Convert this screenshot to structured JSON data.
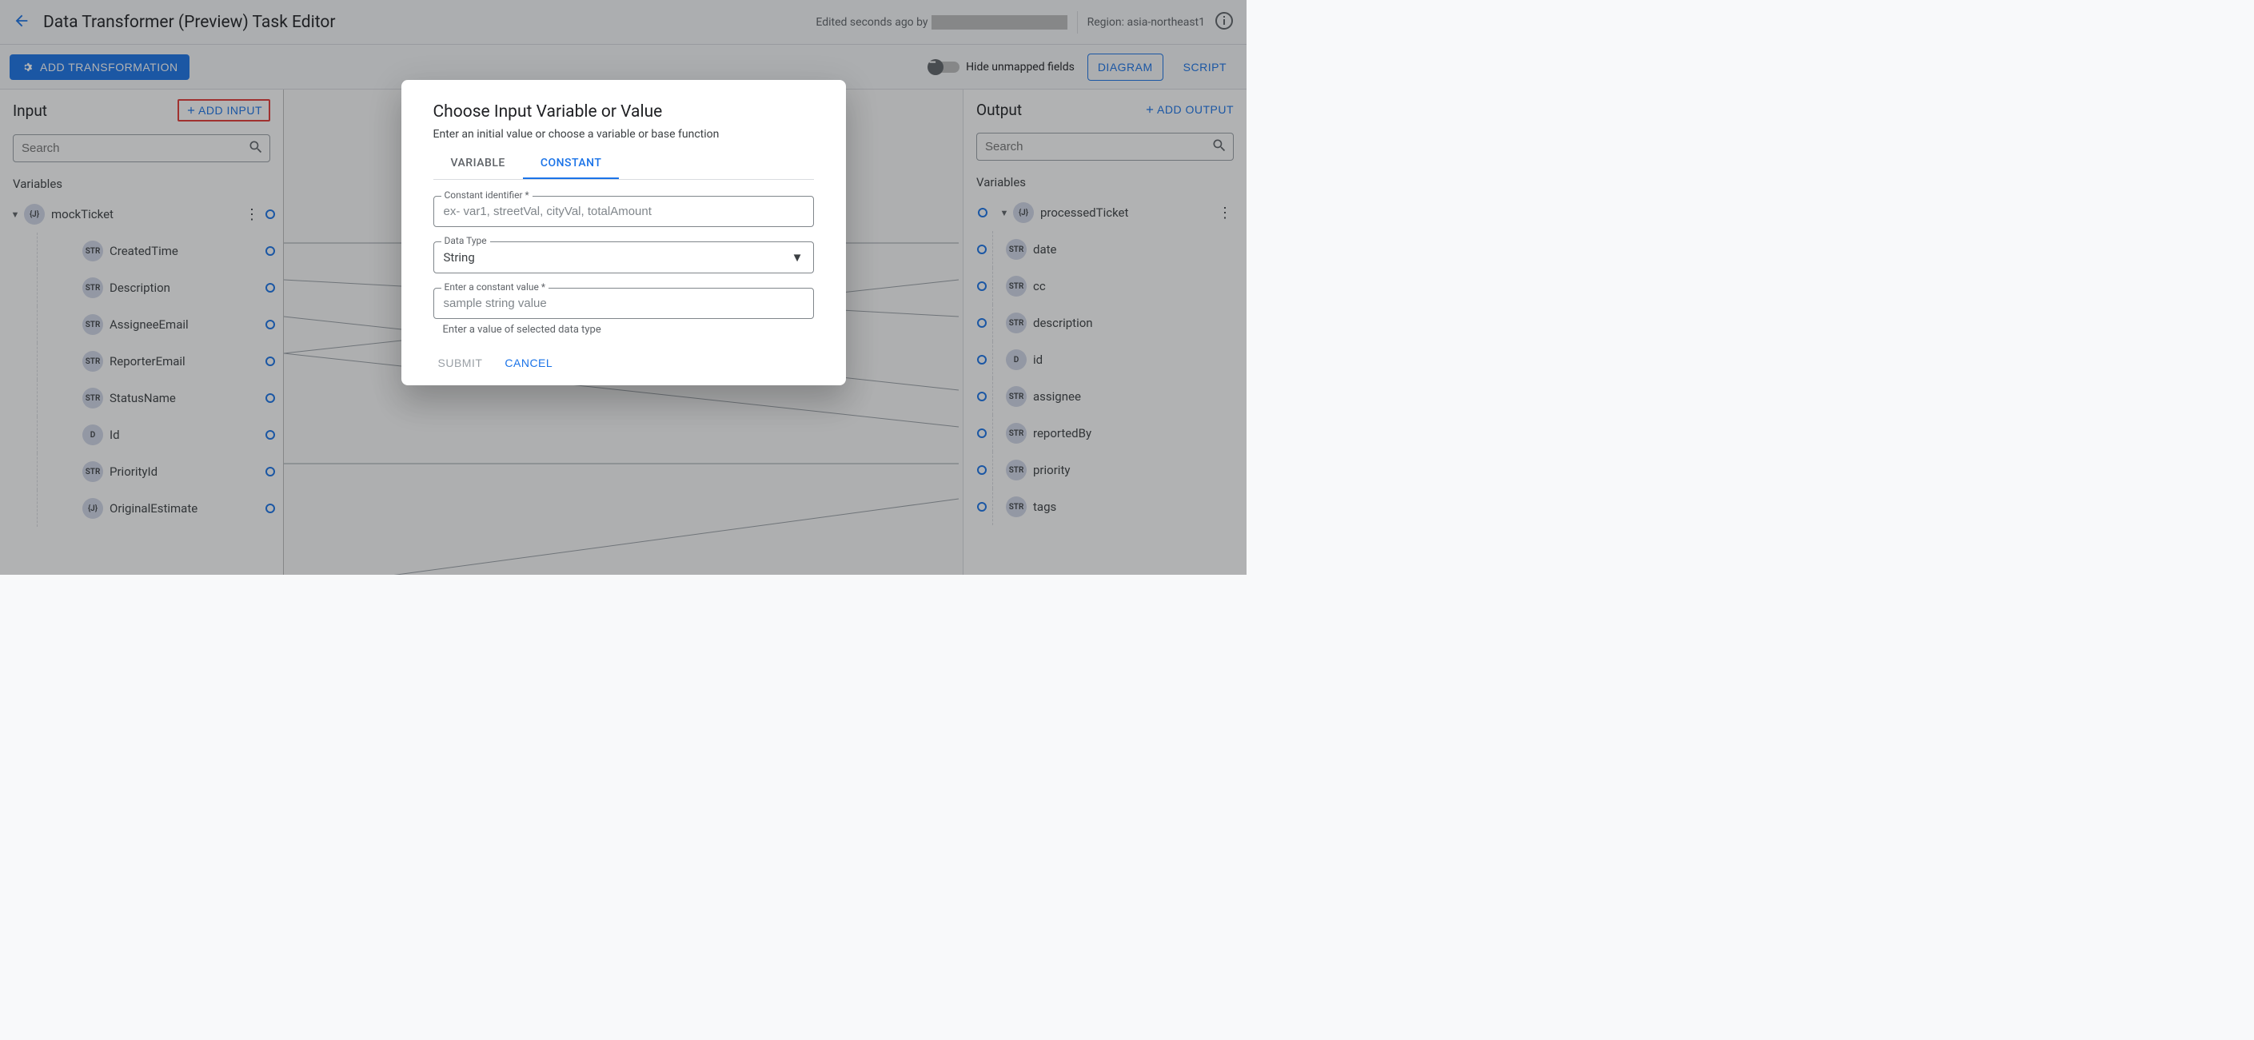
{
  "header": {
    "title": "Data Transformer (Preview) Task Editor",
    "edited_prefix": "Edited seconds ago by",
    "region_label": "Region: asia-northeast1"
  },
  "toolbar": {
    "add_transformation": "ADD TRANSFORMATION",
    "hide_unmapped": "Hide unmapped fields",
    "view_diagram": "DIAGRAM",
    "view_script": "SCRIPT"
  },
  "input_panel": {
    "title": "Input",
    "add_button": "ADD INPUT",
    "search_placeholder": "Search",
    "variables_label": "Variables",
    "root": {
      "type": "{J}",
      "name": "mockTicket"
    },
    "fields": [
      {
        "type": "STR",
        "name": "CreatedTime"
      },
      {
        "type": "STR",
        "name": "Description"
      },
      {
        "type": "STR",
        "name": "AssigneeEmail"
      },
      {
        "type": "STR",
        "name": "ReporterEmail"
      },
      {
        "type": "STR",
        "name": "StatusName"
      },
      {
        "type": "D",
        "name": "Id"
      },
      {
        "type": "STR",
        "name": "PriorityId"
      },
      {
        "type": "{J}",
        "name": "OriginalEstimate"
      }
    ]
  },
  "output_panel": {
    "title": "Output",
    "add_button": "ADD OUTPUT",
    "search_placeholder": "Search",
    "variables_label": "Variables",
    "root": {
      "type": "{J}",
      "name": "processedTicket"
    },
    "fields": [
      {
        "type": "STR",
        "name": "date"
      },
      {
        "type": "STR",
        "name": "cc"
      },
      {
        "type": "STR",
        "name": "description"
      },
      {
        "type": "D",
        "name": "id"
      },
      {
        "type": "STR",
        "name": "assignee"
      },
      {
        "type": "STR",
        "name": "reportedBy"
      },
      {
        "type": "STR",
        "name": "priority"
      },
      {
        "type": "STR",
        "name": "tags"
      }
    ]
  },
  "dialog": {
    "title": "Choose Input Variable or Value",
    "subtitle": "Enter an initial value or choose a variable or base function",
    "tab_variable": "VARIABLE",
    "tab_constant": "CONSTANT",
    "constant_id_label": "Constant identifier *",
    "constant_id_placeholder": "ex- var1, streetVal, cityVal, totalAmount",
    "data_type_label": "Data Type",
    "data_type_value": "String",
    "constant_value_label": "Enter a constant value *",
    "constant_value_placeholder": "sample string value",
    "helper_text": "Enter a value of selected data type",
    "submit": "SUBMIT",
    "cancel": "CANCEL"
  }
}
